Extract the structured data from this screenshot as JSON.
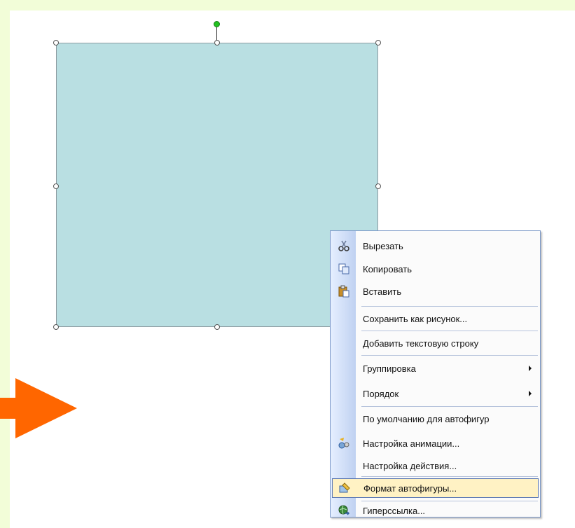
{
  "menu": {
    "items": [
      {
        "label": "Вырезать",
        "icon": "scissors-icon"
      },
      {
        "label": "Копировать",
        "icon": "copy-icon"
      },
      {
        "label": "Вставить",
        "icon": "paste-icon"
      },
      {
        "label": "Сохранить как рисунок..."
      },
      {
        "label": "Добавить текстовую строку"
      },
      {
        "label": "Группировка",
        "submenu": true
      },
      {
        "label": "Порядок",
        "submenu": true
      },
      {
        "label": "По умолчанию для автофигур"
      },
      {
        "label": "Настройка анимации...",
        "icon": "animation-icon"
      },
      {
        "label": "Настройка действия..."
      },
      {
        "label": "Формат автофигуры...",
        "icon": "format-shape-icon",
        "highlighted": true
      },
      {
        "label": "Гиперссылка...",
        "icon": "hyperlink-globe-icon"
      }
    ]
  },
  "colors": {
    "background": "#f2fdd8",
    "shape_fill": "#b9dfe2",
    "arrow": "#ff6600",
    "highlight": "#fff2c4"
  }
}
